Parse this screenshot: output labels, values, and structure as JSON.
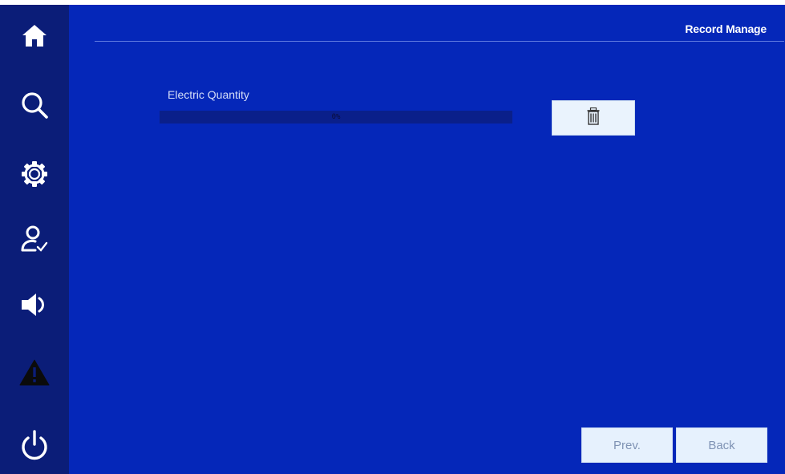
{
  "header": {
    "title": "Record Manage"
  },
  "sidebar": {
    "items": [
      {
        "icon": "home-icon"
      },
      {
        "icon": "search-icon"
      },
      {
        "icon": "settings-gear-icon"
      },
      {
        "icon": "user-check-icon"
      },
      {
        "icon": "speaker-icon"
      },
      {
        "icon": "warning-icon"
      },
      {
        "icon": "power-icon"
      }
    ]
  },
  "main": {
    "electric_label": "Electric Quantity",
    "progress": {
      "value_percent": 0,
      "text": "0%"
    },
    "delete_icon": "trash-icon"
  },
  "footer": {
    "prev_label": "Prev.",
    "back_label": "Back"
  },
  "colors": {
    "background": "#0527b9",
    "sidebar": "#0b1d78",
    "button_bg": "#e6f1fd",
    "button_text": "#7f93b4"
  }
}
